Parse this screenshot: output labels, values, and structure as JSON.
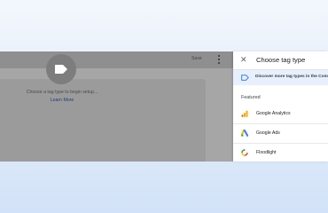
{
  "toolbar": {
    "save_label": "Save"
  },
  "workspace": {
    "empty_message": "Choose a tag type to begin setup...",
    "learn_more": "Learn More"
  },
  "panel": {
    "title": "Choose tag type",
    "close_glyph": "✕",
    "discover_text": "Discover more tag types in the Com",
    "featured_heading": "Featured",
    "items": [
      {
        "label": "Google Analytics",
        "icon": "google-analytics-icon"
      },
      {
        "label": "Google Ads",
        "icon": "google-ads-icon"
      },
      {
        "label": "Floodlight",
        "icon": "floodlight-icon"
      }
    ]
  },
  "colors": {
    "accent": "#1a73e8",
    "panel_highlight": "#e8f0fe",
    "analytics_orange": "#f9ab00",
    "ads_blue": "#4285f4",
    "ads_yellow": "#fbbc04",
    "ads_green": "#34a853"
  }
}
